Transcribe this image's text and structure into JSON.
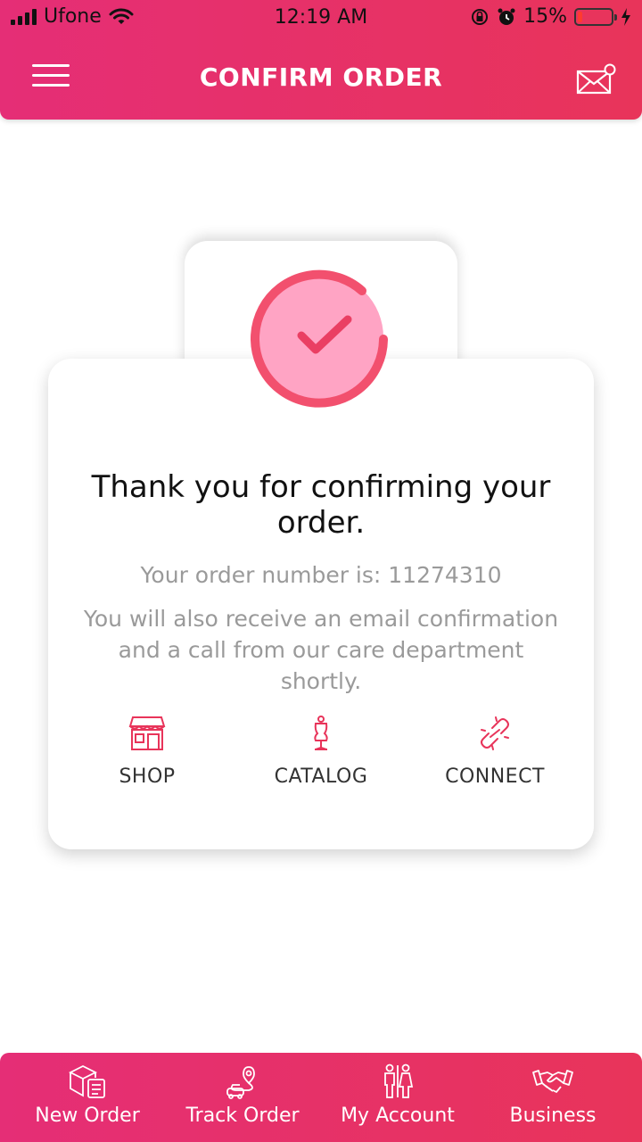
{
  "status_bar": {
    "carrier": "Ufone",
    "time": "12:19 AM",
    "battery_percent": "15%"
  },
  "header": {
    "title": "CONFIRM ORDER",
    "menu_icon": "hamburger-menu-icon",
    "mail_icon": "mail-notification-icon"
  },
  "confirmation": {
    "icon": "checkmark-circle-icon",
    "heading": "Thank you for confirming your order.",
    "order_number_text": "Your order number is: 11274310",
    "info_text": "You will also receive an email confirmation and a call from our care department shortly."
  },
  "actions": [
    {
      "label": "SHOP",
      "icon": "storefront-icon"
    },
    {
      "label": "CATALOG",
      "icon": "mannequin-icon"
    },
    {
      "label": "CONNECT",
      "icon": "link-icon"
    }
  ],
  "bottom_nav": [
    {
      "label": "New Order",
      "icon": "box-checklist-icon"
    },
    {
      "label": "Track Order",
      "icon": "route-pin-icon"
    },
    {
      "label": "My Account",
      "icon": "people-icon"
    },
    {
      "label": "Business",
      "icon": "handshake-icon"
    }
  ],
  "colors": {
    "brand_start": "#e52e76",
    "brand_end": "#e8345a",
    "check_ring": "#f2506e",
    "check_fill": "#ffa4c4",
    "icon_accent": "#e8345a"
  }
}
